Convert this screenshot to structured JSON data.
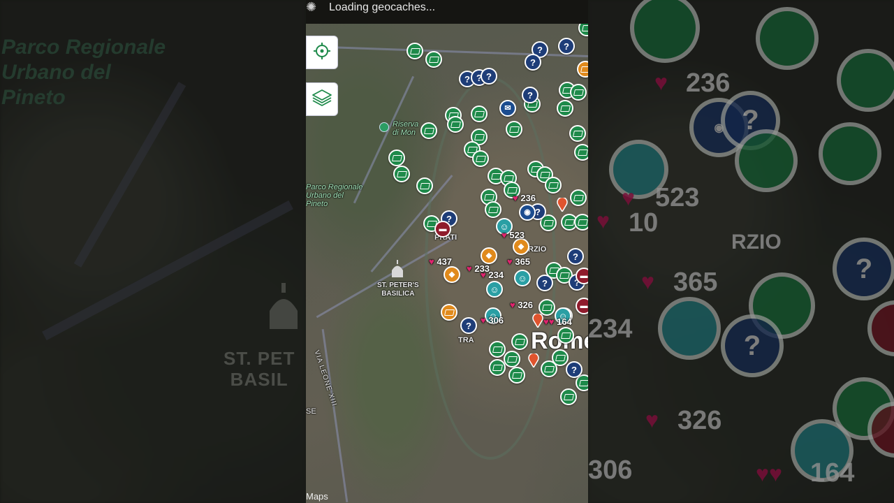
{
  "status": {
    "text": "Loading geocaches..."
  },
  "controls": {
    "locate": "locate-icon",
    "layers": "layers-icon"
  },
  "map": {
    "labels": {
      "park": "Parco Regionale\nUrbano del\nPineto",
      "riserva": "Riserva\ndi Mon",
      "prati": "PRATI",
      "basilica": "ST. PETER'S\nBASILICA",
      "via": "VIA LEONE XIII",
      "trastevere": "TRA",
      "rome": "Rome",
      "campo": "RZIO",
      "se": "SE"
    },
    "counts": [
      "236",
      "523",
      "437",
      "233",
      "365",
      "234",
      "326",
      "306",
      "164"
    ],
    "attribution": "Maps"
  },
  "background": {
    "left_park": "Parco Regionale\nUrbano del\nPineto",
    "left_basilica": "ST. PET\nBASIL",
    "right_counts": [
      "236",
      "523",
      "365",
      "234",
      "326",
      "306",
      "164"
    ],
    "right_campo": "RZIO",
    "right_ten": "10"
  },
  "colors": {
    "traditional": "#1e8a4a",
    "mystery": "#1e3d78",
    "virtual": "#2a9fa4",
    "multi": "#e08a1c",
    "webcam": "#8f1b2c",
    "favorite_heart": "#e0246e"
  }
}
